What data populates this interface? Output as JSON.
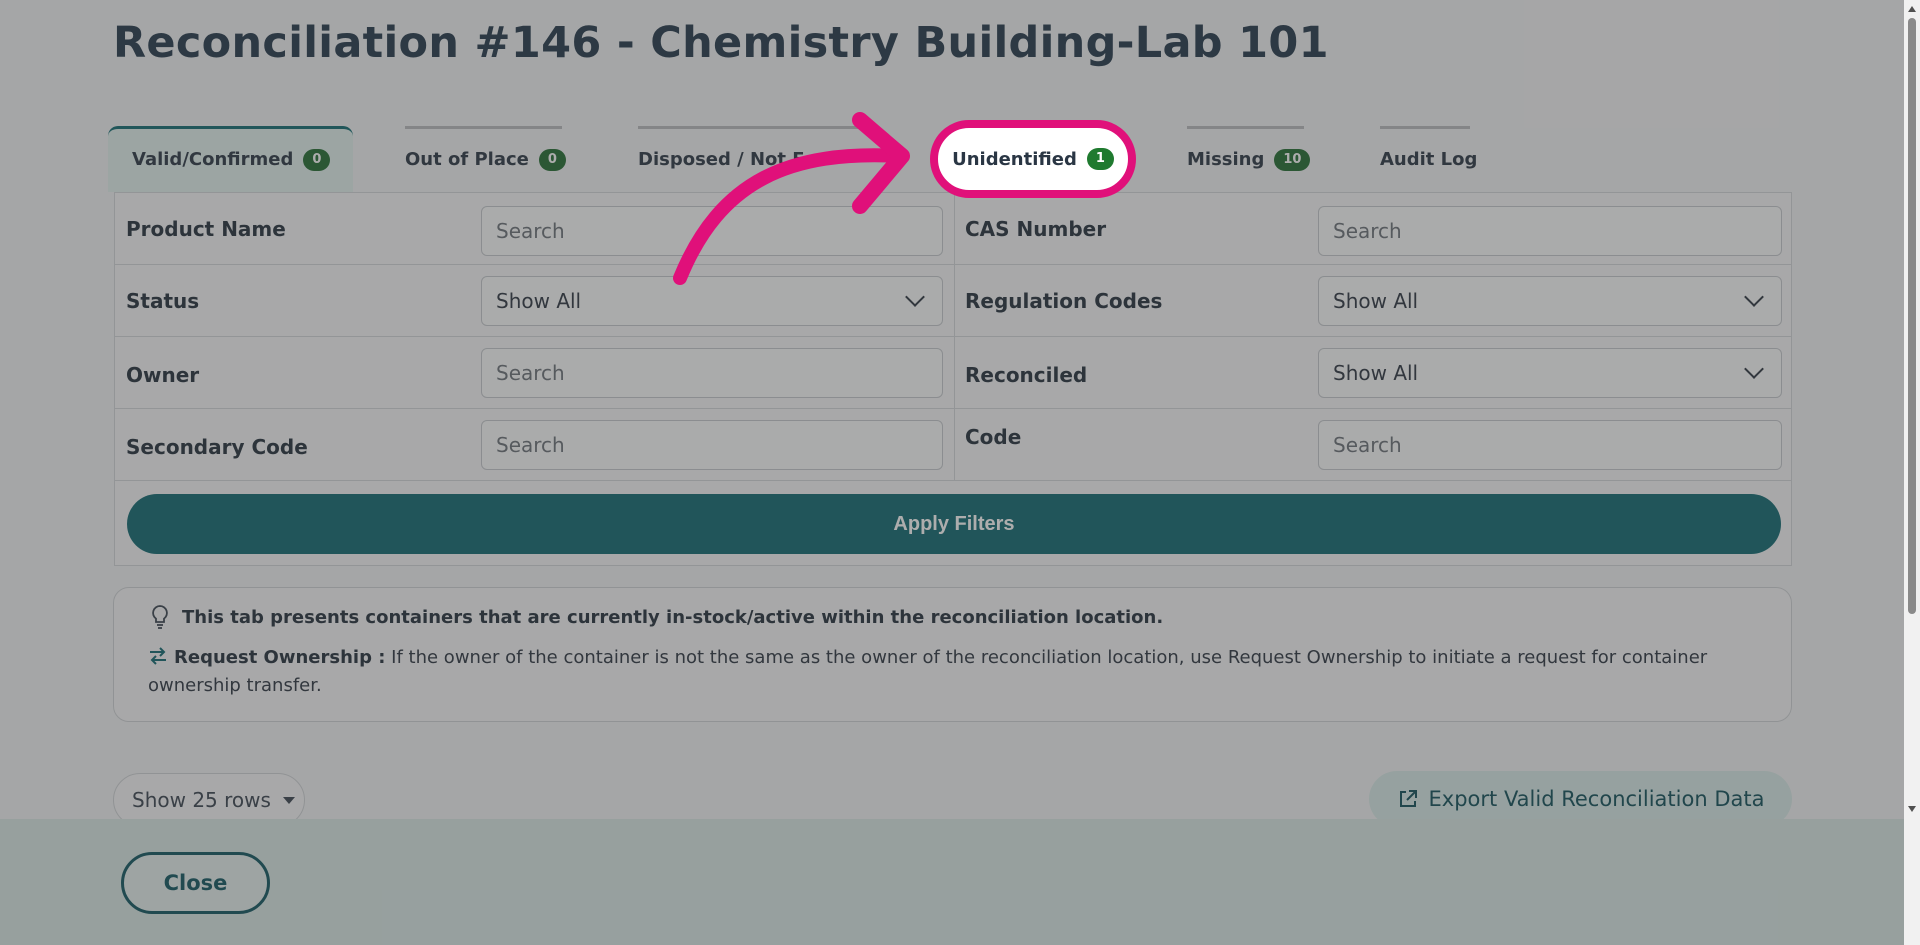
{
  "page_title": "Reconciliation #146 - Chemistry Building-Lab 101",
  "tabs": [
    {
      "label": "Valid/Confirmed",
      "count": "0"
    },
    {
      "label": "Out of Place",
      "count": "0"
    },
    {
      "label": "Disposed / Not Fo",
      "count": ""
    },
    {
      "label": "Unidentified",
      "count": "1"
    },
    {
      "label": "Missing",
      "count": "10"
    },
    {
      "label": "Audit Log",
      "count": ""
    }
  ],
  "filters": {
    "product_name": {
      "label": "Product Name",
      "placeholder": "Search"
    },
    "cas_number": {
      "label": "CAS Number",
      "placeholder": "Search"
    },
    "status": {
      "label": "Status",
      "value": "Show All"
    },
    "regulation_codes": {
      "label": "Regulation Codes",
      "value": "Show All"
    },
    "owner": {
      "label": "Owner",
      "placeholder": "Search"
    },
    "reconciled": {
      "label": "Reconciled",
      "value": "Show All"
    },
    "secondary_code": {
      "label": "Secondary Code",
      "placeholder": "Search"
    },
    "code": {
      "label": "Code",
      "placeholder": "Search"
    },
    "apply_label": "Apply Filters"
  },
  "info": {
    "line1": "This tab presents containers that are currently in-stock/active within the reconciliation location.",
    "request_label": "Request Ownership :",
    "request_text": " If the owner of the container is not the same as the owner of the reconciliation location, use Request Ownership to initiate a request for container ownership transfer."
  },
  "rows_select": "Show 25 rows",
  "export_label": "Export Valid Reconciliation Data",
  "close_label": "Close",
  "colors": {
    "accent": "#0f6870",
    "highlight": "#e0107a",
    "badge": "#1f6b2f"
  }
}
